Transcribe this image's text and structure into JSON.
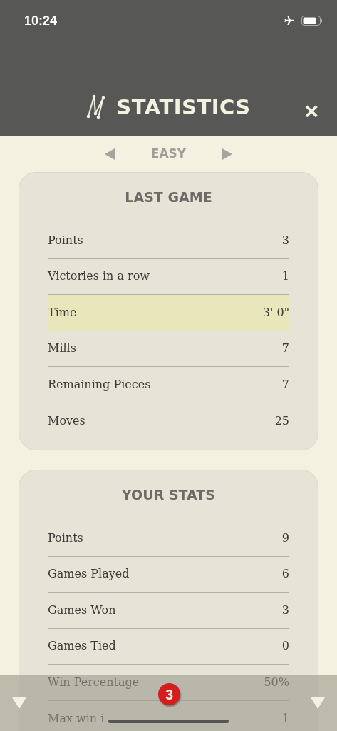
{
  "status_bar": {
    "time": "10:24",
    "airplane_mode": true
  },
  "header": {
    "title": "STATISTICS",
    "close": "×"
  },
  "level_selector": {
    "label": "EASY"
  },
  "sections": [
    {
      "title": "LAST GAME",
      "rows": [
        {
          "label": "Points",
          "value": "3",
          "highlighted": false
        },
        {
          "label": "Victories in a row",
          "value": "1",
          "highlighted": false
        },
        {
          "label": "Time",
          "value": "3' 0\"",
          "highlighted": true
        },
        {
          "label": "Mills",
          "value": "7",
          "highlighted": false
        },
        {
          "label": "Remaining Pieces",
          "value": "7",
          "highlighted": false
        },
        {
          "label": "Moves",
          "value": "25",
          "highlighted": false
        }
      ]
    },
    {
      "title": "YOUR STATS",
      "rows": [
        {
          "label": "Points",
          "value": "9",
          "highlighted": false
        },
        {
          "label": "Games Played",
          "value": "6",
          "highlighted": false
        },
        {
          "label": "Games Won",
          "value": "3",
          "highlighted": false
        },
        {
          "label": "Games Tied",
          "value": "0",
          "highlighted": false
        },
        {
          "label": "Win Percentage",
          "value": "50%",
          "highlighted": false
        },
        {
          "label": "Max win i",
          "value": "1",
          "highlighted": false
        }
      ]
    }
  ],
  "bottom_bar": {
    "badge": "3"
  }
}
